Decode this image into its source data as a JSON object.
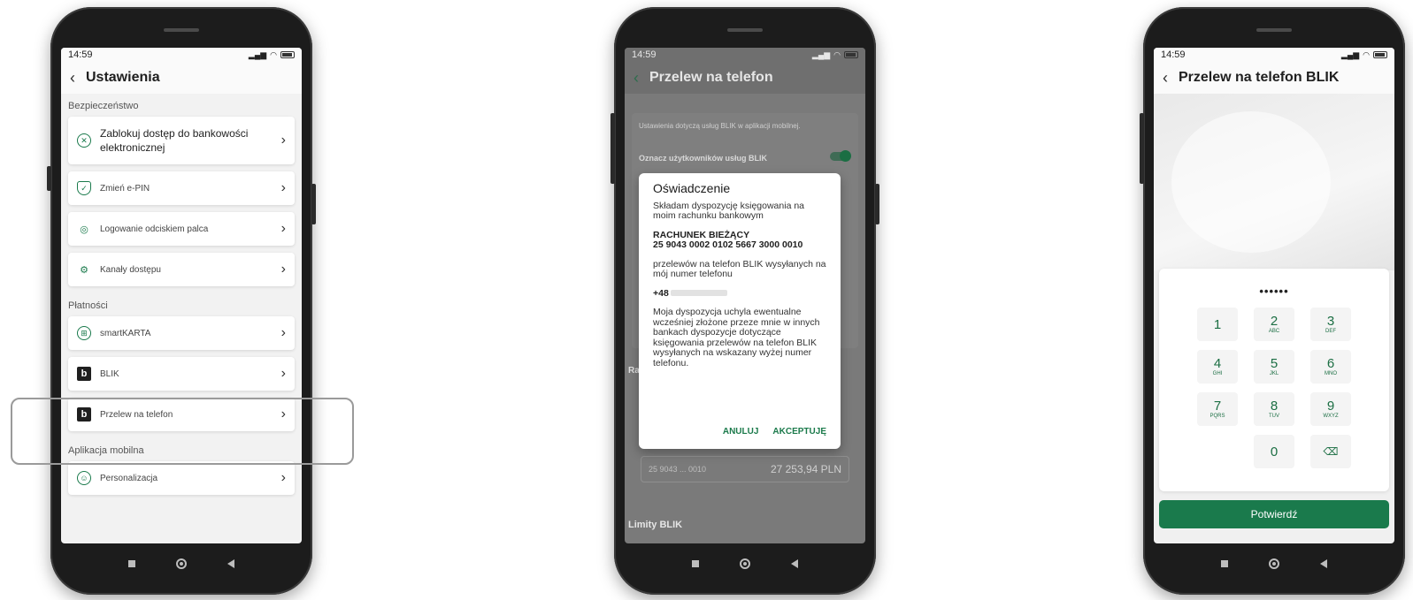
{
  "status": {
    "time": "14:59",
    "signal": "⁴ᴳ"
  },
  "phone1": {
    "title": "Ustawienia",
    "section_security": "Bezpieczeństwo",
    "items_security": [
      {
        "label": "Zablokuj dostęp do bankowości elektronicznej",
        "icon": "block-icon"
      },
      {
        "label": "Zmień e-PIN",
        "icon": "shield-icon"
      },
      {
        "label": "Logowanie odciskiem palca",
        "icon": "fingerprint-icon"
      },
      {
        "label": "Kanały dostępu",
        "icon": "gear-icon"
      }
    ],
    "section_payments": "Płatności",
    "items_payments": [
      {
        "label": "smartKARTA",
        "icon": "card-icon"
      },
      {
        "label": "BLIK",
        "icon": "blik-icon"
      },
      {
        "label": "Przelew na telefon",
        "icon": "blik-icon"
      }
    ],
    "section_app": "Aplikacja mobilna",
    "items_app": [
      {
        "label": "Personalizacja",
        "icon": "user-icon"
      }
    ]
  },
  "phone2": {
    "title": "Przelew na telefon",
    "bg_note": "Ustawienia dotyczą usług BLIK w aplikacji mobilnej.",
    "bg_toggle_label": "Oznacz użytkowników usług BLIK",
    "bg_ra": "Ra",
    "bg_account_number": "25 9043 ... 0010",
    "bg_account_amount": "27 253,94 PLN",
    "bg_limits": "Limity BLIK",
    "dialog": {
      "title": "Oświadczenie",
      "intro": "Składam dyspozycję księgowania na moim rachunku bankowym",
      "account_name": "RACHUNEK BIEŻĄCY",
      "account_number": "25 9043 0002 0102 5667 3000 0010",
      "transfers": "przelewów na telefon BLIK wysyłanych na mój numer telefonu",
      "phone_prefix": "+48",
      "statement": "Moja dyspozycja uchyla ewentualne wcześniej złożone przeze mnie w innych bankach dyspozycje dotyczące księgowania przelewów na telefon BLIK wysyłanych na wskazany wyżej numer telefonu.",
      "cancel": "ANULUJ",
      "accept": "AKCEPTUJĘ"
    }
  },
  "phone3": {
    "title": "Przelew na telefon BLIK",
    "pin_mask": "••••••",
    "keys": [
      {
        "d": "1",
        "l": ""
      },
      {
        "d": "2",
        "l": "ABC"
      },
      {
        "d": "3",
        "l": "DEF"
      },
      {
        "d": "4",
        "l": "GHI"
      },
      {
        "d": "5",
        "l": "JKL"
      },
      {
        "d": "6",
        "l": "MNO"
      },
      {
        "d": "7",
        "l": "PQRS"
      },
      {
        "d": "8",
        "l": "TUV"
      },
      {
        "d": "9",
        "l": "WXYZ"
      }
    ],
    "key_zero": "0",
    "confirm": "Potwierdź"
  }
}
